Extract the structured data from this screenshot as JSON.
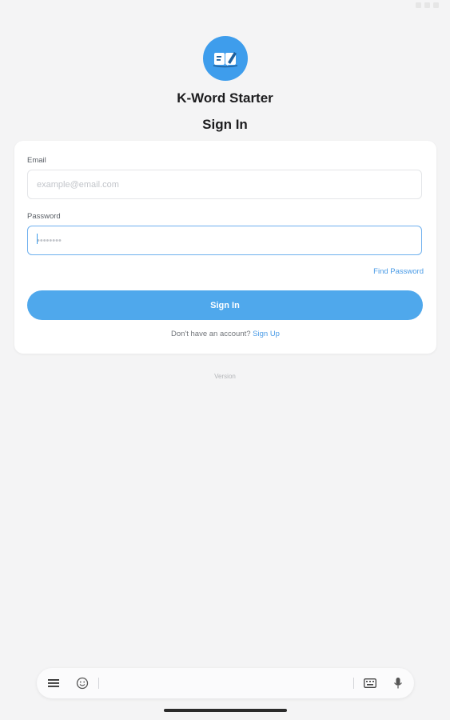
{
  "app": {
    "name": "K-Word Starter",
    "page_title": "Sign In"
  },
  "form": {
    "email_label": "Email",
    "email_placeholder": "example@email.com",
    "email_value": "",
    "password_label": "Password",
    "password_placeholder": "••••••••",
    "password_value": "",
    "find_password": "Find Password",
    "signin_button": "Sign In",
    "signup_prompt": "Don't have an account?",
    "signup_link": "Sign Up"
  },
  "footer": {
    "version": "Version"
  },
  "keyboard_bar": {
    "icons": [
      "menu-icon",
      "emoji-icon",
      "keyboard-icon",
      "microphone-icon"
    ]
  },
  "colors": {
    "accent": "#4fa8ec",
    "logo_bg": "#3e9dec",
    "link": "#4a9be6",
    "background": "#f4f4f5"
  }
}
